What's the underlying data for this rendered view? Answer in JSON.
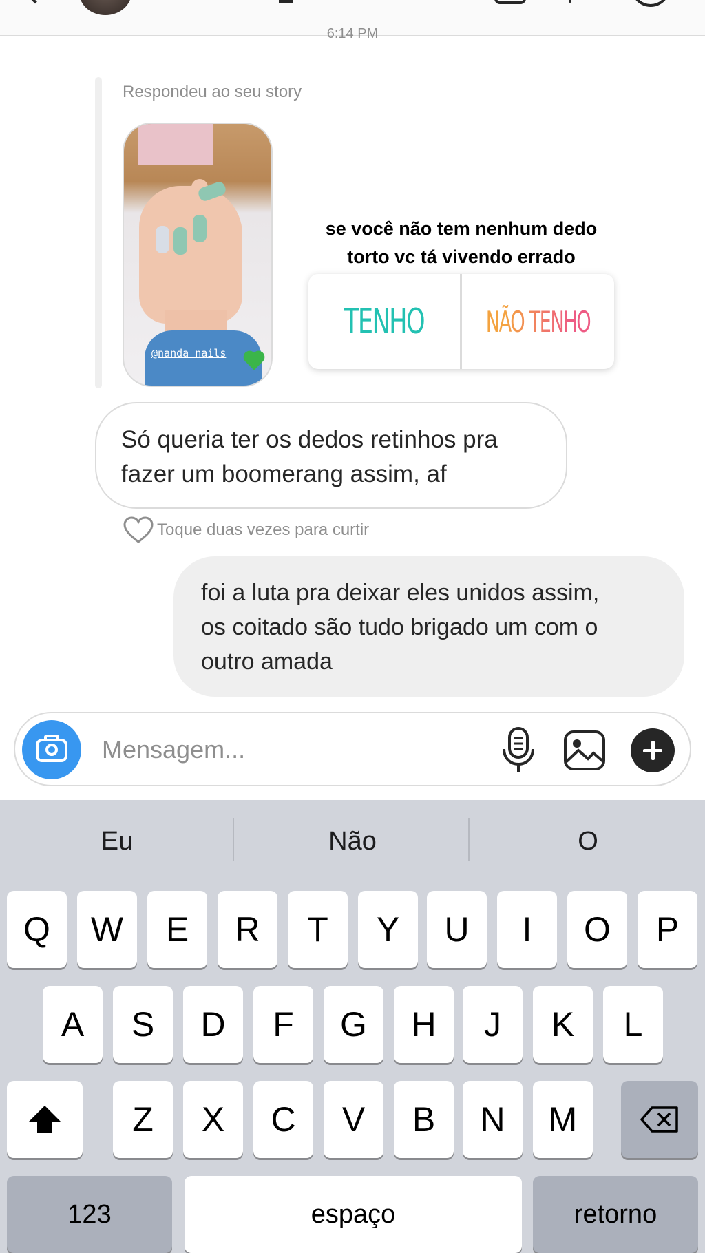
{
  "header": {
    "back_icon": "chevron-left-icon",
    "avatar_icon": "avatar",
    "video_icon": "video-camera-icon",
    "call_icon": "phone-icon",
    "info_icon": "info-icon"
  },
  "thread": {
    "timestamp": "6:14 PM",
    "story_reply": {
      "caption": "Respondeu ao seu story",
      "story_handle": "@nanda_nails",
      "poll_question_line1": "se você não tem nenhum dedo",
      "poll_question_line2": "torto vc tá vivendo errado",
      "poll_option_yes": "TENHO",
      "poll_option_no": "NÃO TENHO",
      "poll_yes_color": "#23c1b2",
      "poll_no_gradient": [
        "#f4a340",
        "#ee5b84"
      ]
    },
    "incoming_message": {
      "line1": "Só queria ter os dedos retinhos pra",
      "line2": "fazer um boomerang assim, af"
    },
    "like_hint": "Toque duas vezes para curtir",
    "outgoing_message": {
      "line1": "foi a luta pra deixar eles unidos assim,",
      "line2": "os coitado são tudo brigado um com o",
      "line3": "outro amada"
    }
  },
  "composer": {
    "placeholder": "Mensagem...",
    "camera_icon": "camera-icon",
    "mic_icon": "microphone-icon",
    "gallery_icon": "gallery-icon",
    "plus_icon": "plus-icon",
    "accent_color": "#3897f0"
  },
  "keyboard": {
    "suggestions": [
      "Eu",
      "Não",
      "O"
    ],
    "row1": [
      "Q",
      "W",
      "E",
      "R",
      "T",
      "Y",
      "U",
      "I",
      "O",
      "P"
    ],
    "row2": [
      "A",
      "S",
      "D",
      "F",
      "G",
      "H",
      "J",
      "K",
      "L"
    ],
    "row3": [
      "Z",
      "X",
      "C",
      "V",
      "B",
      "N",
      "M"
    ],
    "numbers_label": "123",
    "space_label": "espaço",
    "return_label": "retorno",
    "shift_icon": "shift-icon",
    "backspace_icon": "backspace-icon"
  }
}
